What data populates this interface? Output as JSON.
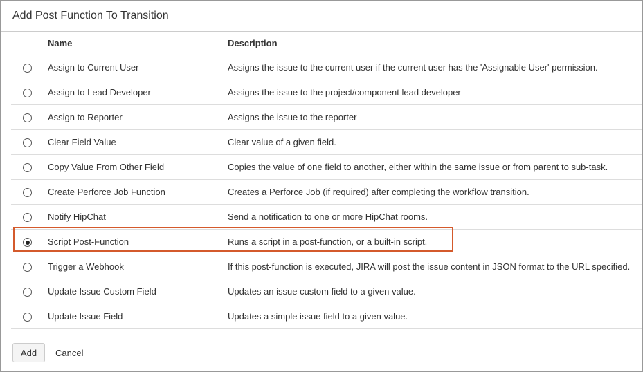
{
  "dialog": {
    "title": "Add Post Function To Transition"
  },
  "table": {
    "columns": {
      "name": "Name",
      "description": "Description"
    },
    "rows": [
      {
        "name": "Assign to Current User",
        "description": "Assigns the issue to the current user if the current user has the 'Assignable User' permission.",
        "selected": false
      },
      {
        "name": "Assign to Lead Developer",
        "description": "Assigns the issue to the project/component lead developer",
        "selected": false
      },
      {
        "name": "Assign to Reporter",
        "description": "Assigns the issue to the reporter",
        "selected": false
      },
      {
        "name": "Clear Field Value",
        "description": "Clear value of a given field.",
        "selected": false
      },
      {
        "name": "Copy Value From Other Field",
        "description": "Copies the value of one field to another, either within the same issue or from parent to sub-task.",
        "selected": false
      },
      {
        "name": "Create Perforce Job Function",
        "description": "Creates a Perforce Job (if required) after completing the workflow transition.",
        "selected": false
      },
      {
        "name": "Notify HipChat",
        "description": "Send a notification to one or more HipChat rooms.",
        "selected": false
      },
      {
        "name": "Script Post-Function",
        "description": "Runs a script in a post-function, or a built-in script.",
        "selected": true
      },
      {
        "name": "Trigger a Webhook",
        "description": "If this post-function is executed, JIRA will post the issue content in JSON format to the URL specified.",
        "selected": false
      },
      {
        "name": "Update Issue Custom Field",
        "description": "Updates an issue custom field to a given value.",
        "selected": false
      },
      {
        "name": "Update Issue Field",
        "description": "Updates a simple issue field to a given value.",
        "selected": false
      }
    ]
  },
  "footer": {
    "add_label": "Add",
    "cancel_label": "Cancel"
  },
  "colors": {
    "highlight": "#d45a2c"
  }
}
